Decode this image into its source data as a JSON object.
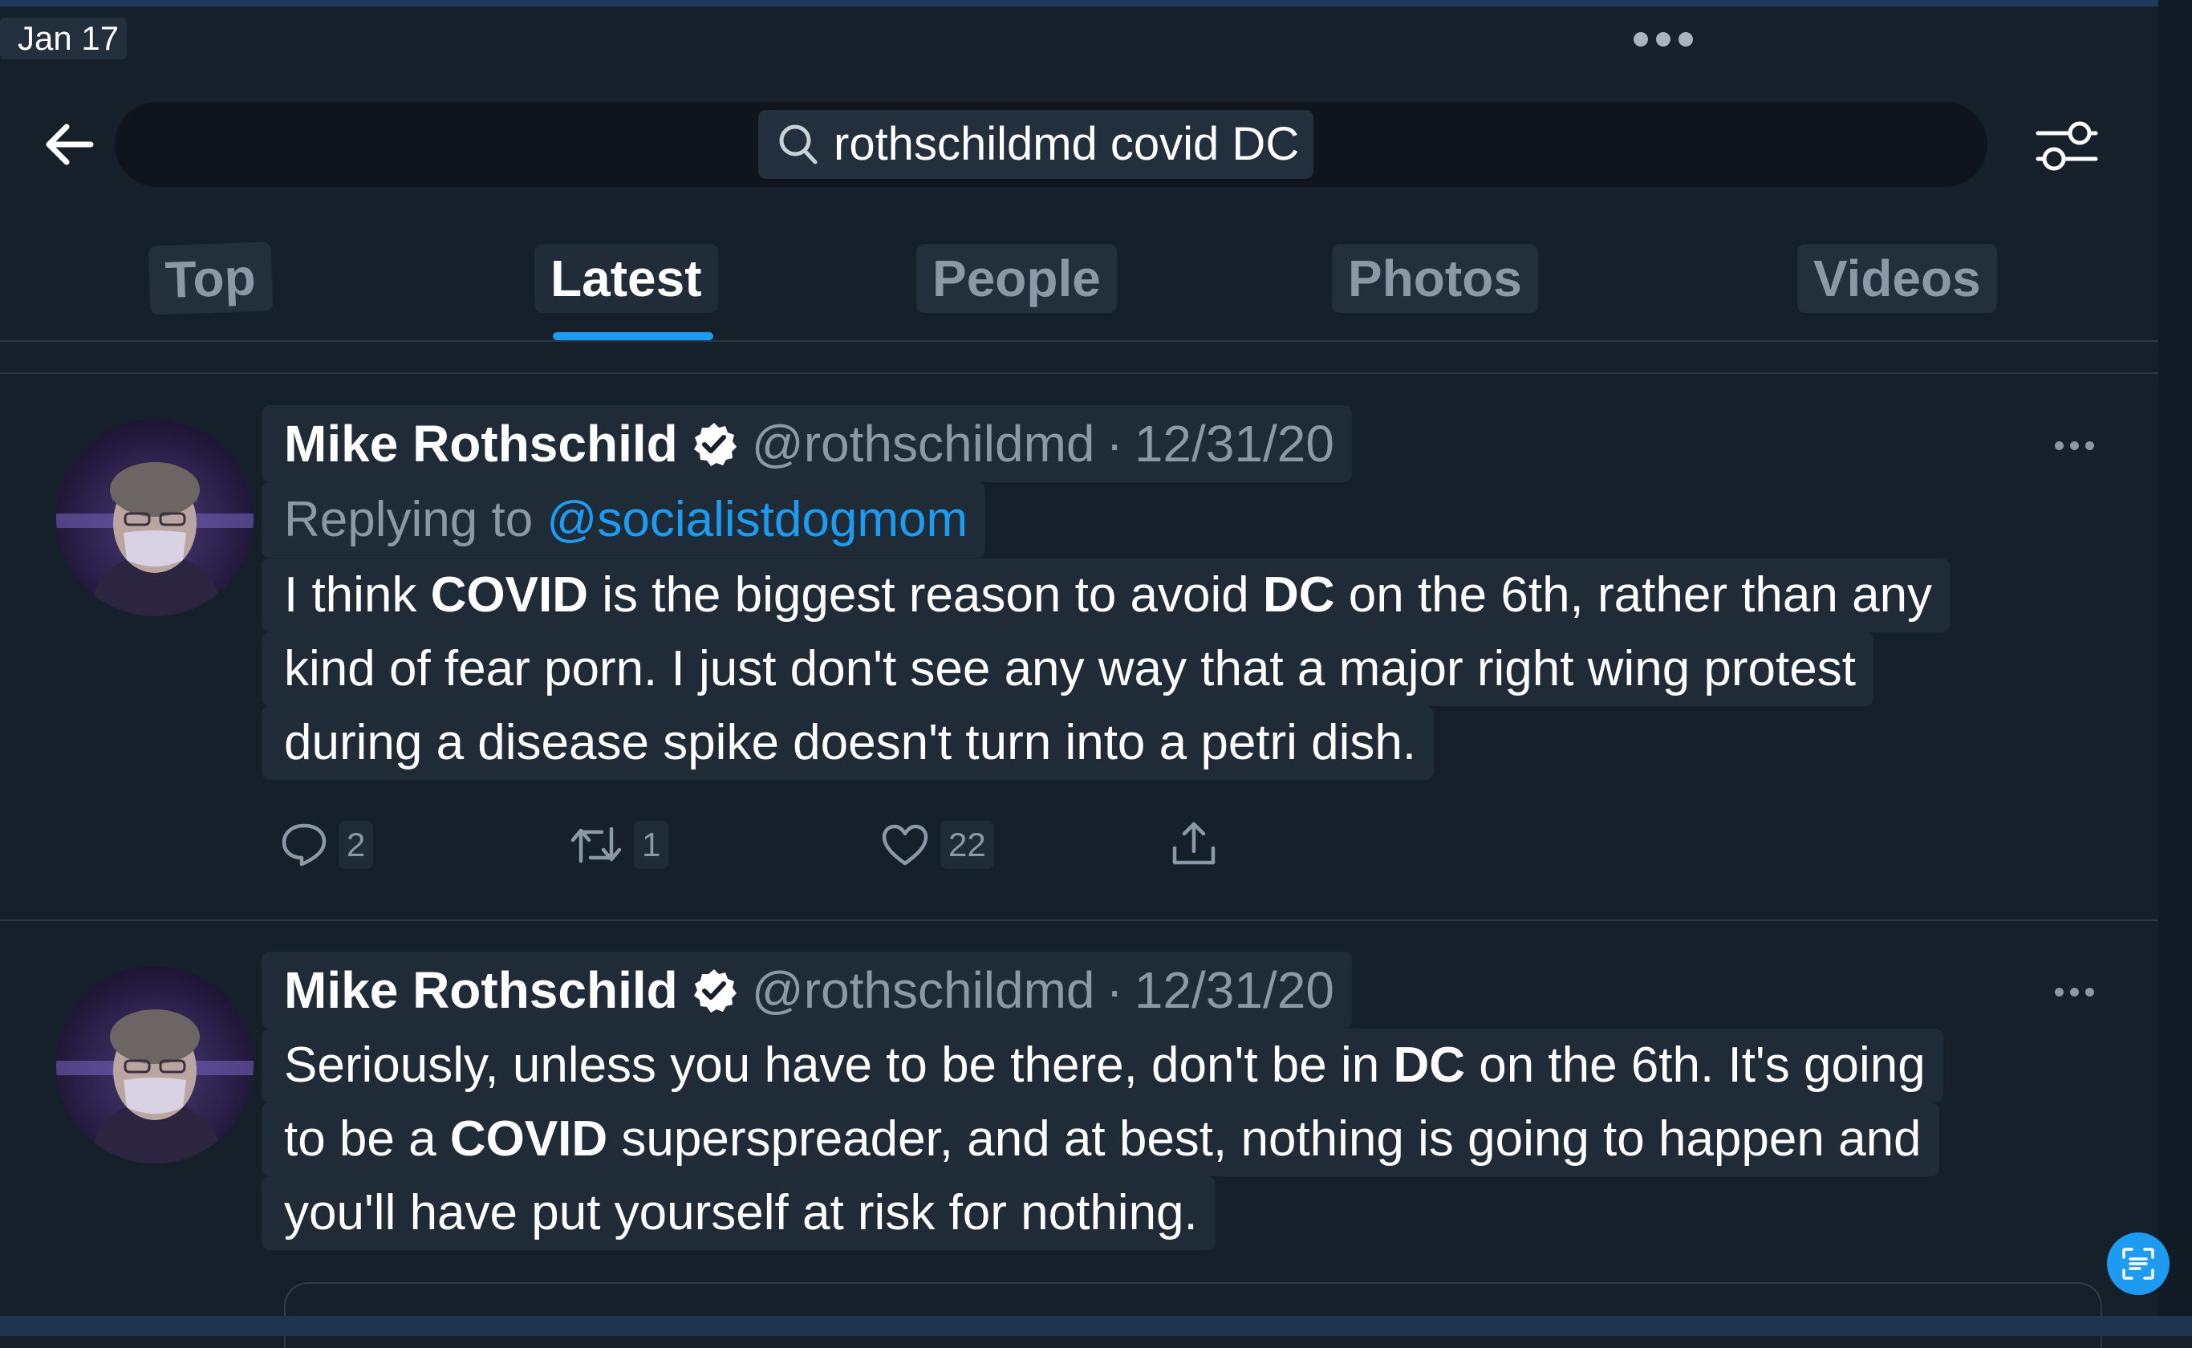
{
  "status_bar": {
    "time": "Jan 17"
  },
  "search": {
    "query": "rothschildmd covid DC"
  },
  "tabs": [
    {
      "label": "Top",
      "active": false
    },
    {
      "label": "Latest",
      "active": true
    },
    {
      "label": "People",
      "active": false
    },
    {
      "label": "Photos",
      "active": false
    },
    {
      "label": "Videos",
      "active": false
    }
  ],
  "tweets": [
    {
      "author_name": "Mike Rothschild",
      "handle": "@rothschildmd",
      "separator": "·",
      "date": "12/31/20",
      "replying_prefix": "Replying to",
      "replying_to": "@socialistdogmom",
      "lines": [
        [
          "I think ",
          "COVID",
          " is the biggest reason to avoid ",
          "DC",
          " on the 6th, rather than any"
        ],
        [
          "kind of fear porn. I just don't see any way that a major right wing protest"
        ],
        [
          "during a disease spike doesn't turn into a petri dish."
        ]
      ],
      "reply_count": "2",
      "retweet_count": "1",
      "like_count": "22"
    },
    {
      "author_name": "Mike Rothschild",
      "handle": "@rothschildmd",
      "separator": "·",
      "date": "12/31/20",
      "lines": [
        [
          "Seriously, unless you have to be there, don't be in ",
          "DC",
          " on the 6th. It's going"
        ],
        [
          "to be a ",
          "COVID",
          " superspreader, and at best, nothing is going to happen and"
        ],
        [
          "you'll have put yourself at risk for nothing."
        ]
      ]
    }
  ],
  "colors": {
    "background": "#15202b",
    "accent": "#1d9bf0",
    "muted": "#8b98a5",
    "text": "#ffffff"
  },
  "icons": {
    "back": "arrow-left-icon",
    "search": "search-icon",
    "filter": "filter-sliders-icon",
    "verified": "verified-badge-icon",
    "reply": "reply-icon",
    "retweet": "retweet-icon",
    "like": "heart-icon",
    "share": "share-icon",
    "more": "more-dots-icon",
    "fab": "scan-text-icon"
  }
}
